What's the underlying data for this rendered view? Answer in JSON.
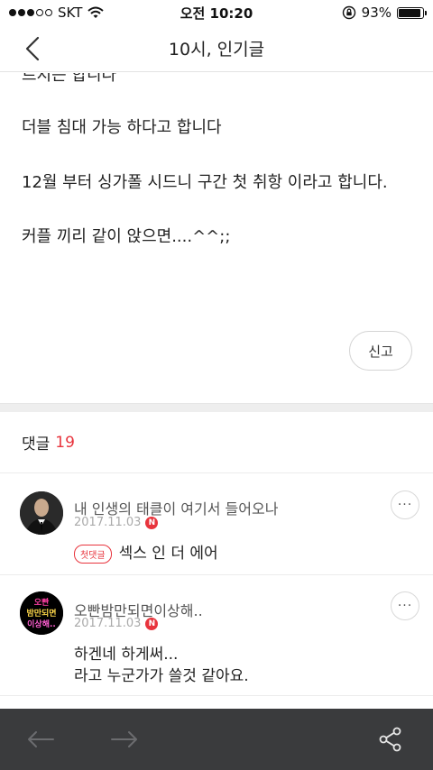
{
  "status_bar": {
    "carrier": "SKT",
    "time": "오전 10:20",
    "battery_percent": "93%",
    "battery_level": 0.93,
    "signal_bars_filled": 3,
    "signal_bars_total": 5,
    "icons": [
      "wifi-icon",
      "rotation-lock-icon",
      "battery-icon"
    ]
  },
  "header": {
    "title": "10시, 인기글",
    "back_icon": "chevron-left-icon"
  },
  "article": {
    "partial_line": "르지는 합니다",
    "lines": [
      "더블 침대 가능 하다고 합니다",
      "12월 부터 싱가폴  시드니 구간 첫 취항 이라고 합니다.",
      "커플 끼리 같이 앉으면....^^;;"
    ],
    "report_label": "신고"
  },
  "comments": {
    "heading": "댓글",
    "count": "19",
    "items": [
      {
        "author": "내 인생의 태클이 여기서 들어오나",
        "date": "2017.11.03",
        "new_badge": "N",
        "first_badge": "첫댓글",
        "text_lines": [
          "섹스 인 더 에어"
        ],
        "avatar": "man-in-suit-avatar"
      },
      {
        "author": "오빤밤만되면이상해..",
        "date": "2017.11.03",
        "new_badge": "N",
        "first_badge": "",
        "text_lines": [
          "하겐네 하게써...",
          "라고 누군가가 쓸것 같아요."
        ],
        "avatar": "neon-text-avatar",
        "avatar_text": [
          "오빤",
          "밤만되면",
          "이상해.."
        ]
      }
    ],
    "more_label": "···"
  },
  "toolbar": {
    "back_icon": "arrow-left-icon",
    "forward_icon": "arrow-right-icon",
    "share_icon": "share-icon"
  },
  "colors": {
    "accent_red": "#e8343d",
    "toolbar_bg": "#3a3b3d",
    "divider": "#ececec"
  }
}
